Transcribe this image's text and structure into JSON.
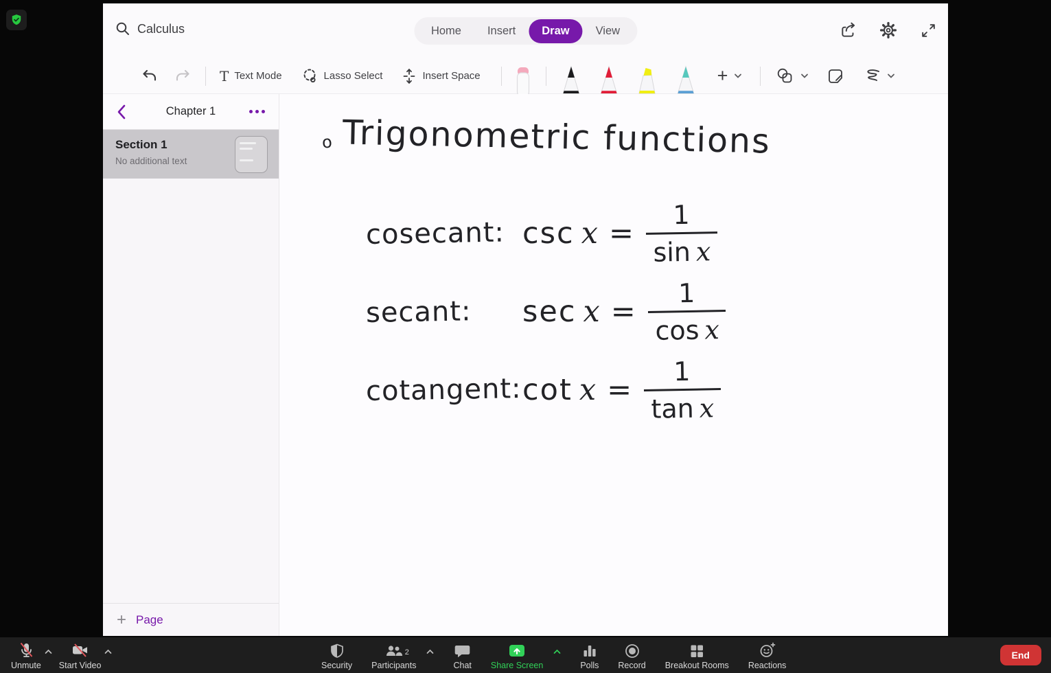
{
  "app": {
    "search": {
      "value": "Calculus"
    },
    "tabs": [
      {
        "label": "Home",
        "active": false
      },
      {
        "label": "Insert",
        "active": false
      },
      {
        "label": "Draw",
        "active": true
      },
      {
        "label": "View",
        "active": false
      }
    ],
    "ribbon": {
      "text_mode_label": "Text Mode",
      "lasso_label": "Lasso Select",
      "insert_space_label": "Insert Space",
      "plus_label": "+",
      "pens": [
        {
          "name": "eraser",
          "color": "#f4a9bc"
        },
        {
          "name": "pen-black",
          "color": "#1c1c1e"
        },
        {
          "name": "pen-red",
          "color": "#e11d38"
        },
        {
          "name": "highlighter-yellow",
          "color": "#f0ee13"
        },
        {
          "name": "pen-teal",
          "color": "#57c8bd"
        }
      ]
    },
    "sidebar": {
      "title": "Chapter 1",
      "pages": [
        {
          "title": "Section 1",
          "subtitle": "No additional text",
          "selected": true
        }
      ],
      "add_page_label": "Page"
    },
    "canvas": {
      "bullet": "o",
      "title": "Trigonometric functions",
      "rows": [
        {
          "label": "cosecant:",
          "fn": "csc",
          "variable": "x",
          "equals": "=",
          "numerator": "1",
          "den_fn": "sin",
          "den_var": "x"
        },
        {
          "label": "secant:",
          "fn": "sec",
          "variable": "x",
          "equals": "=",
          "numerator": "1",
          "den_fn": "cos",
          "den_var": "x"
        },
        {
          "label": "cotangent:",
          "fn": "cot",
          "variable": "x",
          "equals": "=",
          "numerator": "1",
          "den_fn": "tan",
          "den_var": "x"
        }
      ]
    },
    "colors": {
      "accent": "#7719aa"
    }
  },
  "meeting": {
    "items": {
      "unmute": "Unmute",
      "start_video": "Start Video",
      "security": "Security",
      "participants": "Participants",
      "participants_count": "2",
      "chat": "Chat",
      "share_screen": "Share Screen",
      "polls": "Polls",
      "record": "Record",
      "breakout_rooms": "Breakout Rooms",
      "reactions": "Reactions",
      "end": "End"
    },
    "colors": {
      "share_green": "#31d158",
      "end_red": "#d03434",
      "shield_green": "#27c93f"
    }
  }
}
